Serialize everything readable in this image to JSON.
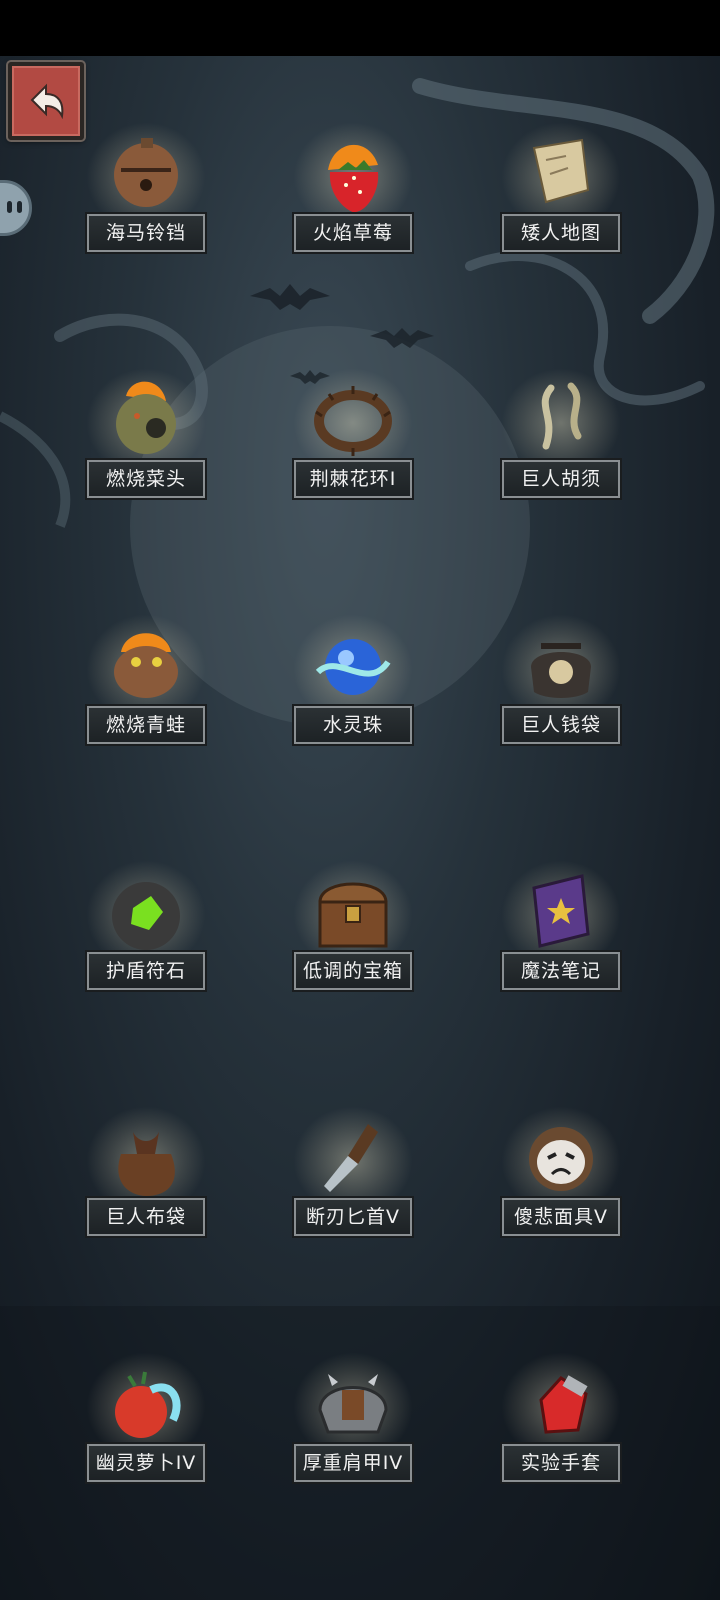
{
  "header": {
    "back_label": ""
  },
  "items": [
    {
      "label": "海马铃铛",
      "icon": "bell-icon"
    },
    {
      "label": "火焰草莓",
      "icon": "flaming-strawberry-icon"
    },
    {
      "label": "矮人地图",
      "icon": "map-scroll-icon"
    },
    {
      "label": "燃烧菜头",
      "icon": "burning-turnip-icon"
    },
    {
      "label": "荆棘花环I",
      "icon": "thorn-wreath-icon"
    },
    {
      "label": "巨人胡须",
      "icon": "giant-beard-icon"
    },
    {
      "label": "燃烧青蛙",
      "icon": "burning-frog-icon"
    },
    {
      "label": "水灵珠",
      "icon": "water-orb-icon"
    },
    {
      "label": "巨人钱袋",
      "icon": "money-bag-icon"
    },
    {
      "label": "护盾符石",
      "icon": "shield-rune-stone-icon"
    },
    {
      "label": "低调的宝箱",
      "icon": "treasure-chest-icon"
    },
    {
      "label": "魔法笔记",
      "icon": "magic-book-icon"
    },
    {
      "label": "巨人布袋",
      "icon": "cloth-sack-icon"
    },
    {
      "label": "断刃匕首V",
      "icon": "broken-dagger-icon"
    },
    {
      "label": "傻悲面具V",
      "icon": "mask-icon"
    },
    {
      "label": "幽灵萝卜IV",
      "icon": "ghost-radish-icon"
    },
    {
      "label": "厚重肩甲IV",
      "icon": "shoulder-armor-icon"
    },
    {
      "label": "实验手套",
      "icon": "red-glove-icon"
    }
  ],
  "colors": {
    "back_button": "#b24a43",
    "label_bg": "#23282b",
    "label_border": "#8a8f92"
  }
}
